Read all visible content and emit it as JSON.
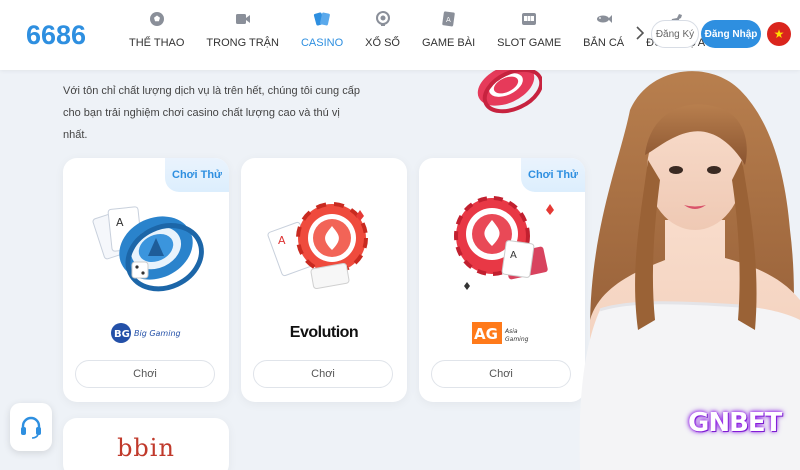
{
  "header": {
    "logo": "6686",
    "nav": [
      {
        "label": "THỂ THAO",
        "icon": "soccer-ball-icon"
      },
      {
        "label": "TRONG TRẬN",
        "icon": "video-icon"
      },
      {
        "label": "CASINO",
        "icon": "cards-icon",
        "active": true
      },
      {
        "label": "XỔ SỐ",
        "icon": "lottery-icon"
      },
      {
        "label": "GAME BÀI",
        "icon": "card-game-icon"
      },
      {
        "label": "SLOT GAME",
        "icon": "slot-machine-icon"
      },
      {
        "label": "BẮN CÁ",
        "icon": "fish-icon"
      },
      {
        "label": "ĐUA NGỰA",
        "icon": "horse-icon"
      }
    ],
    "register": "Đăng Ký",
    "login": "Đăng Nhập",
    "flag": "vietnam-flag-icon"
  },
  "intro": "Với tôn chỉ chất lượng dịch vụ là trên hết, chúng tôi cung cấp cho bạn trải nghiệm chơi casino chất lượng cao và thú vị nhất.",
  "cards": [
    {
      "badge": "Chơi Thử",
      "brand": "Big Gaming",
      "brand_short": "BG",
      "play": "Chơi"
    },
    {
      "badge": "",
      "brand": "Evolution",
      "play": "Chơi"
    },
    {
      "badge": "Chơi Thử",
      "brand": "Asia Gaming",
      "brand_short": "AG",
      "play": "Chơi"
    }
  ],
  "small_card": {
    "brand": "bbin"
  },
  "watermark": "GNBET",
  "colors": {
    "accent": "#2e8fe0",
    "red": "#e53935",
    "background": "#eef2f7"
  }
}
